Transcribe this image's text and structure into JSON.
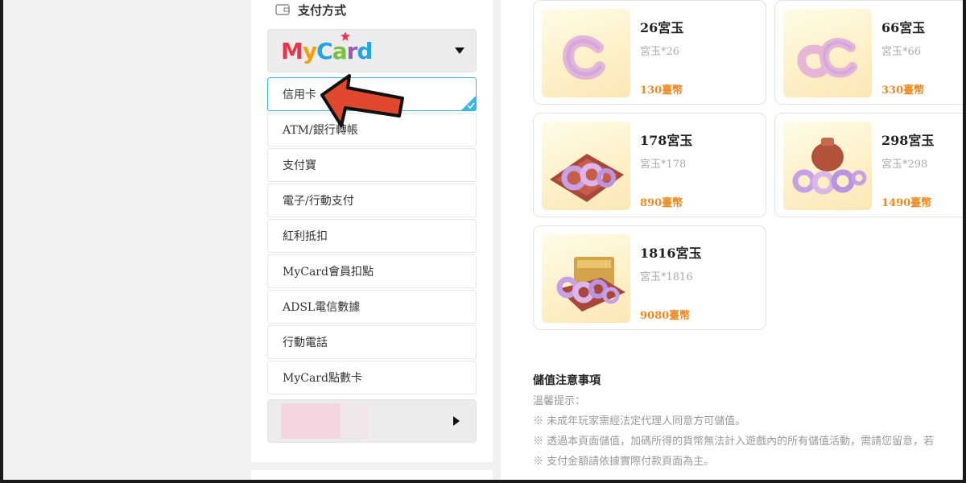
{
  "payment": {
    "header": "支付方式",
    "provider": "MyCard",
    "methods": [
      {
        "label": "信用卡"
      },
      {
        "label": "ATM/銀行轉帳"
      },
      {
        "label": "支付寶"
      },
      {
        "label": "電子/行動支付"
      },
      {
        "label": "紅利抵扣"
      },
      {
        "label": "MyCard會員扣點"
      },
      {
        "label": "ADSL電信數據"
      },
      {
        "label": "行動電話"
      },
      {
        "label": "MyCard點數卡"
      }
    ],
    "selected_index": 0
  },
  "products": [
    {
      "name": "26宮玉",
      "sub": "宮玉*26",
      "price": "130臺幣"
    },
    {
      "name": "66宮玉",
      "sub": "宮玉*66",
      "price": "330臺幣"
    },
    {
      "name": "178宮玉",
      "sub": "宮玉*178",
      "price": "890臺幣"
    },
    {
      "name": "298宮玉",
      "sub": "宮玉*298",
      "price": "1490臺幣"
    },
    {
      "name": "1816宮玉",
      "sub": "宮玉*1816",
      "price": "9080臺幣"
    }
  ],
  "notes": {
    "title": "儲值注意事項",
    "lines": [
      "溫馨提示：",
      "※ 未成年玩家需經法定代理人同意方可儲值。",
      "※ 透過本頁面儲值，加碼所得的貨幣無法計入遊戲內的所有儲值活動，需請您留意，若",
      "※ 支付金額請依據實際付款頁面為主。"
    ]
  },
  "colors": {
    "accent_blue": "#3ab7e8",
    "price_orange": "#ef8a21",
    "arrow_red": "#e0482e"
  }
}
